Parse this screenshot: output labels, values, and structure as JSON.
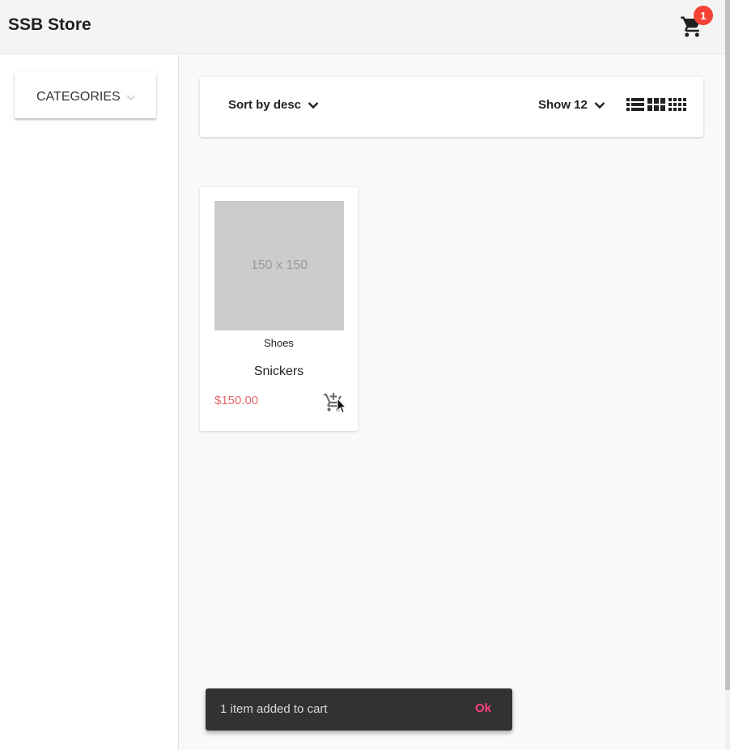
{
  "app": {
    "title": "SSB Store"
  },
  "cart": {
    "badge_count": "1",
    "icon": "shopping-cart-icon"
  },
  "sidebar": {
    "categories_label": "CATEGORIES",
    "chevron_icon": "chevron-down-icon"
  },
  "toolbar": {
    "sort_label": "Sort by desc",
    "show_label": "Show 12",
    "view_icons": [
      "list-view-icon",
      "grid-view-icon",
      "compact-grid-view-icon"
    ]
  },
  "products": [
    {
      "image_placeholder": "150 x 150",
      "category": "Shoes",
      "name": "Snickers",
      "price": "$150.00"
    }
  ],
  "snackbar": {
    "message": "1 item added to cart",
    "action": "Ok"
  },
  "colors": {
    "price": "#e56a6a",
    "badge": "#f44336",
    "snackbar_action": "#ff4081",
    "snackbar_bg": "#323232"
  }
}
